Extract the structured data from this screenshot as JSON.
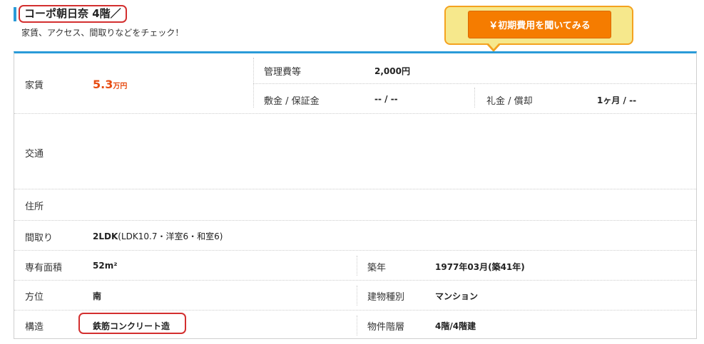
{
  "header": {
    "title": "コーポ朝日奈 4階／",
    "subtitle": "家賃、アクセス、間取りなどをチェック！"
  },
  "callout": {
    "button_label": "￥初期費用を聞いてみる"
  },
  "colors": {
    "accent_blue": "#2a9bd8",
    "price_orange": "#e74c12",
    "button_orange": "#f57c00",
    "highlight_red": "#d32f2f",
    "callout_yellow": "#f6e88c"
  },
  "details": {
    "rent_label": "家賃",
    "rent_value": "5.3",
    "rent_unit": "万円",
    "mgmt_label": "管理費等",
    "mgmt_value": "2,000円",
    "deposit_label": "敷金 / 保証金",
    "deposit_value": "-- / --",
    "keymoney_label": "礼金 / 償却",
    "keymoney_value": "1ヶ月 / --",
    "access_label": "交通",
    "address_label": "住所",
    "layout_label": "間取り",
    "layout_value": "2LDK",
    "layout_detail": "(LDK10.7・洋室6・和室6)",
    "area_label": "専有面積",
    "area_value": "52m²",
    "built_label": "築年",
    "built_value": "1977年03月(築41年)",
    "direction_label": "方位",
    "direction_value": "南",
    "building_type_label": "建物種別",
    "building_type_value": "マンション",
    "structure_label": "構造",
    "structure_value": "鉄筋コンクリート造",
    "floor_label": "物件階層",
    "floor_value": "4階/4階建"
  }
}
